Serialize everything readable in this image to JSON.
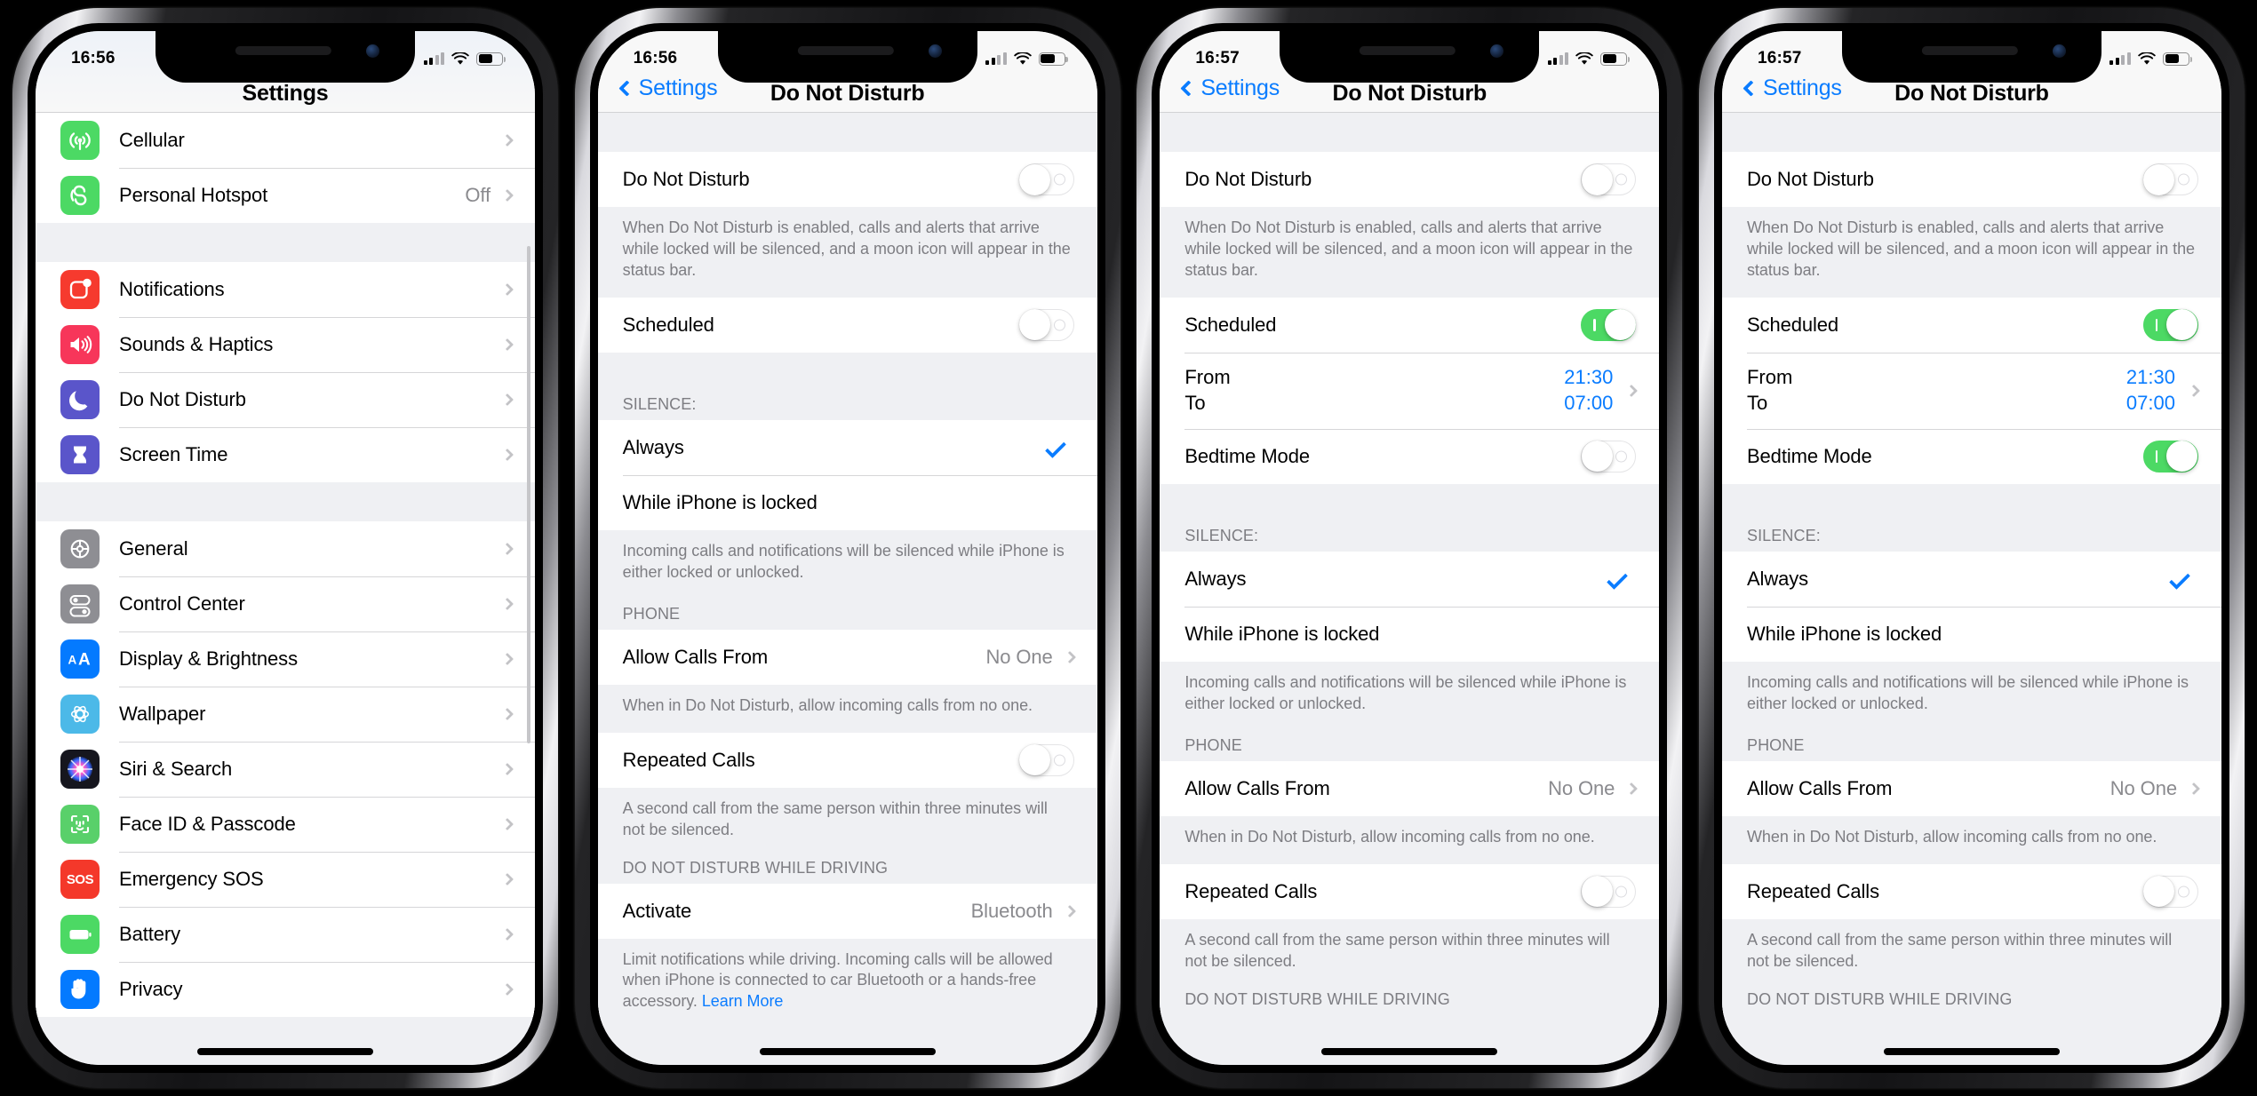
{
  "colors": {
    "accent_blue": "#0a7cff",
    "toggle_on_green": "#4cd964",
    "list_bg": "#eff0f3",
    "secondary_text": "#8a8a8e"
  },
  "phones": [
    {
      "id": "phone-1",
      "status": {
        "time": "16:56"
      },
      "nav": {
        "title": "Settings",
        "back": null
      },
      "screen": "settings-root",
      "sections": [
        {
          "rows": [
            {
              "icon": "cellular-icon",
              "icon_color": "#4cd964",
              "label": "Cellular",
              "value": "",
              "accessory": "chevron"
            },
            {
              "icon": "personal-hotspot-icon",
              "icon_color": "#4cd964",
              "label": "Personal Hotspot",
              "value": "Off",
              "accessory": "chevron"
            }
          ]
        },
        {
          "rows": [
            {
              "icon": "notifications-icon",
              "icon_color": "#f63a2e",
              "label": "Notifications",
              "value": "",
              "accessory": "chevron"
            },
            {
              "icon": "sounds-haptics-icon",
              "icon_color": "#f7365a",
              "label": "Sounds & Haptics",
              "value": "",
              "accessory": "chevron"
            },
            {
              "icon": "do-not-disturb-icon",
              "icon_color": "#5a55ca",
              "label": "Do Not Disturb",
              "value": "",
              "accessory": "chevron"
            },
            {
              "icon": "screen-time-icon",
              "icon_color": "#5a55ca",
              "label": "Screen Time",
              "value": "",
              "accessory": "chevron"
            }
          ]
        },
        {
          "rows": [
            {
              "icon": "general-gear-icon",
              "icon_color": "#8e8e93",
              "label": "General",
              "value": "",
              "accessory": "chevron"
            },
            {
              "icon": "control-center-icon",
              "icon_color": "#8e8e93",
              "label": "Control Center",
              "value": "",
              "accessory": "chevron"
            },
            {
              "icon": "display-brightness-icon",
              "icon_color": "#047aff",
              "label": "Display & Brightness",
              "value": "",
              "accessory": "chevron"
            },
            {
              "icon": "wallpaper-icon",
              "icon_color": "#4cb9e8",
              "label": "Wallpaper",
              "value": "",
              "accessory": "chevron"
            },
            {
              "icon": "siri-search-icon",
              "icon_color": "#1c1c2e",
              "label": "Siri & Search",
              "value": "",
              "accessory": "chevron"
            },
            {
              "icon": "face-id-passcode-icon",
              "icon_color": "#59d06a",
              "label": "Face ID & Passcode",
              "value": "",
              "accessory": "chevron"
            },
            {
              "icon": "emergency-sos-icon",
              "icon_color": "#f4382a",
              "label": "Emergency SOS",
              "value": "",
              "accessory": "chevron"
            },
            {
              "icon": "battery-icon",
              "icon_color": "#4cd964",
              "label": "Battery",
              "value": "",
              "accessory": "chevron"
            },
            {
              "icon": "privacy-hand-icon",
              "icon_color": "#047aff",
              "label": "Privacy",
              "value": "",
              "accessory": "chevron"
            }
          ]
        }
      ]
    },
    {
      "id": "phone-2",
      "status": {
        "time": "16:56"
      },
      "nav": {
        "title": "Do Not Disturb",
        "back": "Settings"
      },
      "screen": "do-not-disturb",
      "dnd_toggle": {
        "label": "Do Not Disturb",
        "on": false
      },
      "dnd_footer": "When Do Not Disturb is enabled, calls and alerts that arrive while locked will be silenced, and a moon icon will appear in the status bar.",
      "scheduled": {
        "label": "Scheduled",
        "on": false
      },
      "schedule_visible": false,
      "silence_header": "SILENCE:",
      "silence_options": [
        {
          "label": "Always",
          "selected": true
        },
        {
          "label": "While iPhone is locked",
          "selected": false
        }
      ],
      "silence_footer": "Incoming calls and notifications will be silenced while iPhone is either locked or unlocked.",
      "phone_header": "PHONE",
      "allow_calls": {
        "label": "Allow Calls From",
        "value": "No One"
      },
      "allow_calls_footer": "When in Do Not Disturb, allow incoming calls from no one.",
      "repeated_calls": {
        "label": "Repeated Calls",
        "on": false
      },
      "repeated_calls_footer": "A second call from the same person within three minutes will not be silenced.",
      "driving_header": "DO NOT DISTURB WHILE DRIVING",
      "activate": {
        "label": "Activate",
        "value": "Bluetooth"
      },
      "driving_footer": "Limit notifications while driving. Incoming calls will be allowed when iPhone is connected to car Bluetooth or a hands-free accessory.",
      "driving_footer_link": "Learn More"
    },
    {
      "id": "phone-3",
      "status": {
        "time": "16:57"
      },
      "nav": {
        "title": "Do Not Disturb",
        "back": "Settings"
      },
      "screen": "do-not-disturb",
      "dnd_toggle": {
        "label": "Do Not Disturb",
        "on": false
      },
      "dnd_footer": "When Do Not Disturb is enabled, calls and alerts that arrive while locked will be silenced, and a moon icon will appear in the status bar.",
      "scheduled": {
        "label": "Scheduled",
        "on": true
      },
      "schedule_visible": true,
      "from": {
        "label": "From",
        "value": "21:30"
      },
      "to": {
        "label": "To",
        "value": "07:00"
      },
      "bedtime_mode": {
        "label": "Bedtime Mode",
        "on": false
      },
      "silence_header": "SILENCE:",
      "silence_options": [
        {
          "label": "Always",
          "selected": true
        },
        {
          "label": "While iPhone is locked",
          "selected": false
        }
      ],
      "silence_footer": "Incoming calls and notifications will be silenced while iPhone is either locked or unlocked.",
      "phone_header": "PHONE",
      "allow_calls": {
        "label": "Allow Calls From",
        "value": "No One"
      },
      "allow_calls_footer": "When in Do Not Disturb, allow incoming calls from no one.",
      "repeated_calls": {
        "label": "Repeated Calls",
        "on": false
      },
      "repeated_calls_footer": "A second call from the same person within three minutes will not be silenced.",
      "driving_header": "DO NOT DISTURB WHILE DRIVING"
    },
    {
      "id": "phone-4",
      "status": {
        "time": "16:57"
      },
      "nav": {
        "title": "Do Not Disturb",
        "back": "Settings"
      },
      "screen": "do-not-disturb",
      "dnd_toggle": {
        "label": "Do Not Disturb",
        "on": false
      },
      "dnd_footer": "When Do Not Disturb is enabled, calls and alerts that arrive while locked will be silenced, and a moon icon will appear in the status bar.",
      "scheduled": {
        "label": "Scheduled",
        "on": true
      },
      "schedule_visible": true,
      "from": {
        "label": "From",
        "value": "21:30"
      },
      "to": {
        "label": "To",
        "value": "07:00"
      },
      "bedtime_mode": {
        "label": "Bedtime Mode",
        "on": true
      },
      "silence_header": "SILENCE:",
      "silence_options": [
        {
          "label": "Always",
          "selected": true
        },
        {
          "label": "While iPhone is locked",
          "selected": false
        }
      ],
      "silence_footer": "Incoming calls and notifications will be silenced while iPhone is either locked or unlocked.",
      "phone_header": "PHONE",
      "allow_calls": {
        "label": "Allow Calls From",
        "value": "No One"
      },
      "allow_calls_footer": "When in Do Not Disturb, allow incoming calls from no one.",
      "repeated_calls": {
        "label": "Repeated Calls",
        "on": false
      },
      "repeated_calls_footer": "A second call from the same person within three minutes will not be silenced.",
      "driving_header": "DO NOT DISTURB WHILE DRIVING"
    }
  ]
}
